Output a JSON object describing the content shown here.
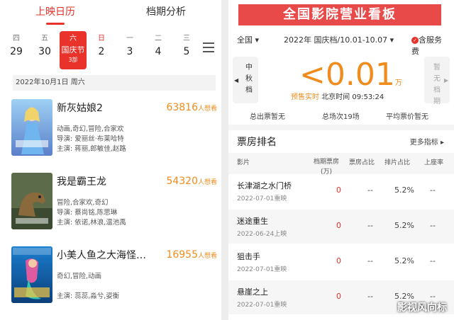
{
  "left": {
    "tabs": [
      "上映日历",
      "档期分析"
    ],
    "days": [
      {
        "weekday": "四",
        "date": "29"
      },
      {
        "weekday": "五",
        "date": "30"
      },
      {
        "weekday": "六",
        "date": "国庆节",
        "count": "3部",
        "selected": true
      },
      {
        "weekday": "日",
        "date": "2"
      },
      {
        "weekday": "一",
        "date": "3"
      },
      {
        "weekday": "二",
        "date": "4"
      },
      {
        "weekday": "三",
        "date": "5"
      }
    ],
    "date_header": "2022年10月1日  周六",
    "movies": [
      {
        "title": "新灰姑娘2",
        "want": "63816",
        "want_unit": "人想看",
        "genre": "动画,奇幻,冒险,合家欢",
        "director": "导演: 爱丽丝·布莱哈特",
        "cast": "主演: 蒋丽,郎敏佳,赵路"
      },
      {
        "title": "我是霸王龙",
        "want": "54320",
        "want_unit": "人想看",
        "genre": "冒险,合家欢,奇幻",
        "director": "导演: 蔡尚铭,陈思琳",
        "cast": "主演: 依诺,林浪,温池禹"
      },
      {
        "title": "小美人鱼之大海怪…",
        "want": "16955",
        "want_unit": "人想看",
        "genre": "奇幻,冒险,动画",
        "director": "",
        "cast": "主演: 蕊蕊,淼兮,姿衡"
      }
    ]
  },
  "right": {
    "banner": "全国影院营业看板",
    "region": "全国",
    "year": "2022年",
    "period": "国庆档/10.01-10.07",
    "service_fee": "含服务费",
    "prev_button": "中秋档",
    "next_button": "暂无档期",
    "box_office": "<0.01",
    "box_office_unit": "万",
    "realtime_label": "预售实时",
    "realtime_time": "北京时间  09:53:24",
    "stats": [
      "总出票暂无",
      "总场次19场",
      "平均票价暂无"
    ],
    "ranking_title": "票房排名",
    "more_metrics": "更多指标",
    "table_headers": [
      "影片",
      "档期票房(万)",
      "票房占比",
      "排片占比",
      "上座率"
    ],
    "rows": [
      {
        "name": "长津湖之水门桥",
        "date": "2022-07-01重映",
        "box": "0",
        "share": "--",
        "sched": "5.2%",
        "attend": "--"
      },
      {
        "name": "迷途重生",
        "date": "2022-06-24上映",
        "box": "0",
        "share": "--",
        "sched": "5.2%",
        "attend": "--"
      },
      {
        "name": "狙击手",
        "date": "2022-07-01重映",
        "box": "0",
        "share": "--",
        "sched": "5.2%",
        "attend": "--"
      },
      {
        "name": "悬崖之上",
        "date": "2022-07-01重映",
        "box": "0",
        "share": "--",
        "sched": "5.2%",
        "attend": "--"
      }
    ],
    "watermark": "影视风向标"
  }
}
